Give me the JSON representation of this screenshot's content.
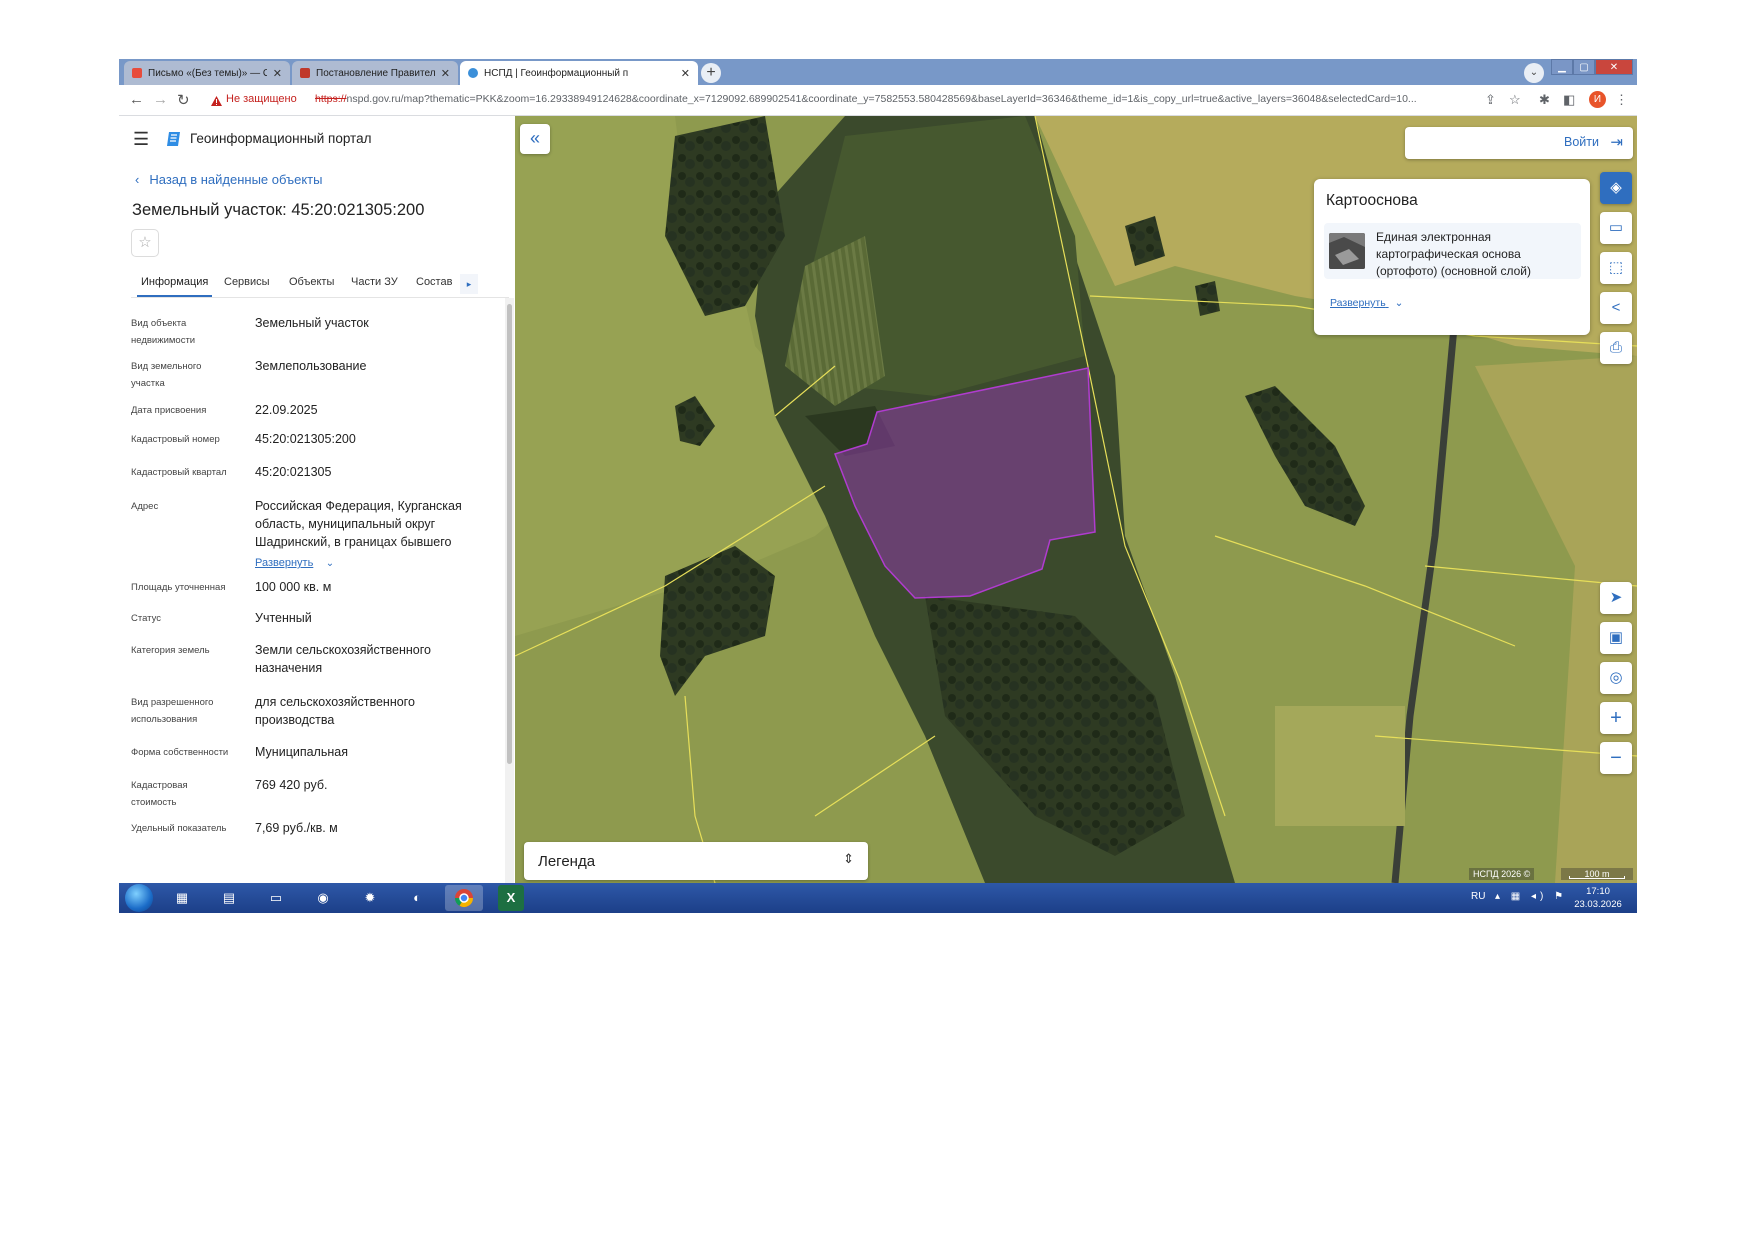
{
  "browser": {
    "tabs": [
      {
        "label": "Письмо «(Без темы)» — Отде",
        "icon": "mail-icon",
        "active": false
      },
      {
        "label": "Постановление Правительства",
        "icon": "document-icon",
        "active": false
      },
      {
        "label": "НСПД | Геоинформационный п",
        "icon": "portal-icon",
        "active": true
      }
    ],
    "new_tab": "+",
    "tab_search": "⌄",
    "window_min": "▁",
    "window_max": "▢",
    "window_close": "✕",
    "back": "←",
    "forward": "→",
    "reload": "↻",
    "security_text": "Не защищено",
    "url_scheme": "https://",
    "url_rest": "nspd.gov.ru/map?thematic=PKK&zoom=16.29338949124628&coordinate_x=7129092.689902541&coordinate_y=7582553.580428569&baseLayerId=36346&theme_id=1&is_copy_url=true&active_layers=36048&selectedCard=10...",
    "profile_initial": "И"
  },
  "portal": {
    "title": "Геоинформационный портал",
    "back_link": "Назад в найденные объекты",
    "parcel_title": "Земельный участок: 45:20:021305:200",
    "tabs": [
      "Информация",
      "Сервисы",
      "Объекты",
      "Части ЗУ",
      "Состав"
    ],
    "tabs_next": "▸",
    "fields": [
      {
        "label": "Вид объекта недвижимости",
        "value": "Земельный участок"
      },
      {
        "label": "Вид земельного участка",
        "value": "Землепользование"
      },
      {
        "label": "Дата присвоения",
        "value": "22.09.2025"
      },
      {
        "label": "Кадастровый номер",
        "value": "45:20:021305:200"
      },
      {
        "label": "Кадастровый квартал",
        "value": "45:20:021305"
      },
      {
        "label": "Адрес",
        "value": "Российская Федерация, Курганская область, муниципальный округ Шадринский, в границах бывшего"
      },
      {
        "label": "Площадь уточненная",
        "value": "100 000 кв. м"
      },
      {
        "label": "Статус",
        "value": "Учтенный"
      },
      {
        "label": "Категория земель",
        "value": "Земли сельскохозяйственного назначения"
      },
      {
        "label": "Вид разрешенного использования",
        "value": "для сельскохозяйственного производства"
      },
      {
        "label": "Форма собственности",
        "value": "Муниципальная"
      },
      {
        "label": "Кадастровая стоимость",
        "value": "769 420 руб."
      },
      {
        "label": "Удельный показатель",
        "value": "7,69 руб./кв. м"
      }
    ],
    "address_expand": "Развернуть"
  },
  "map": {
    "login_label": "Войти",
    "basemap_title": "Картооснова",
    "basemap_name": "Единая электронная картографическая основа (ортофото) (основной слой)",
    "basemap_expand": "Развернуть",
    "legend_label": "Легенда",
    "attribution": "НСПД 2026 ©",
    "scale_label": "100 m",
    "parcel_color": "#8e3aa8"
  },
  "taskbar": {
    "lang": "RU",
    "time": "17:10",
    "date": "23.03.2026"
  }
}
